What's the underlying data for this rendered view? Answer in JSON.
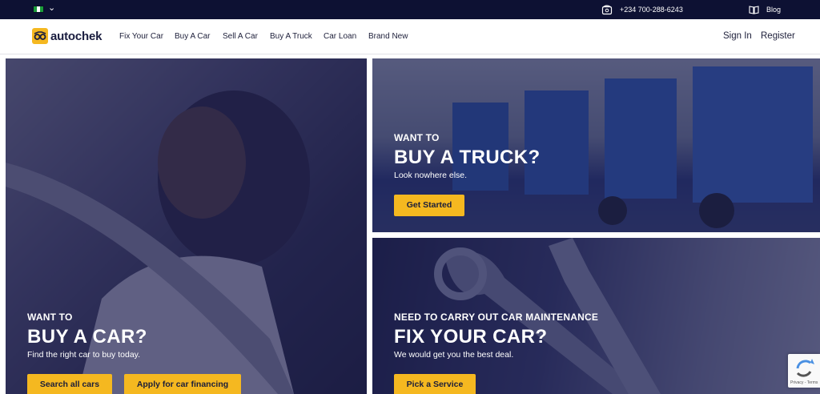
{
  "topbar": {
    "phone": "+234 700-288-6243",
    "blog_label": "Blog",
    "country_flag": "nigeria-flag-icon",
    "colors": {
      "background": "#0d1133"
    }
  },
  "nav": {
    "brand": "autochek",
    "items": [
      {
        "label": "Fix Your Car"
      },
      {
        "label": "Buy A Car"
      },
      {
        "label": "Sell A Car"
      },
      {
        "label": "Buy A Truck"
      },
      {
        "label": "Car Loan"
      },
      {
        "label": "Brand New"
      }
    ],
    "sign_in": "Sign In",
    "register": "Register"
  },
  "hero": {
    "buy_car": {
      "eyebrow": "WANT TO",
      "headline": "BUY A CAR?",
      "subtext": "Find the right car to buy today.",
      "button_primary": "Search all cars",
      "button_secondary": "Apply for car financing"
    },
    "buy_truck": {
      "eyebrow": "WANT TO",
      "headline": "BUY A TRUCK?",
      "subtext": "Look nowhere else.",
      "button": "Get Started"
    },
    "fix_car": {
      "eyebrow": "NEED TO CARRY OUT CAR MAINTENANCE",
      "headline": "FIX YOUR CAR?",
      "subtext": "We would get you the best deal.",
      "button": "Pick a Service"
    }
  },
  "recaptcha": {
    "footer": "Privacy - Terms"
  },
  "colors": {
    "accent": "#f5b820",
    "overlay": "#1c1e50",
    "text_dark": "#1d1f3a"
  }
}
